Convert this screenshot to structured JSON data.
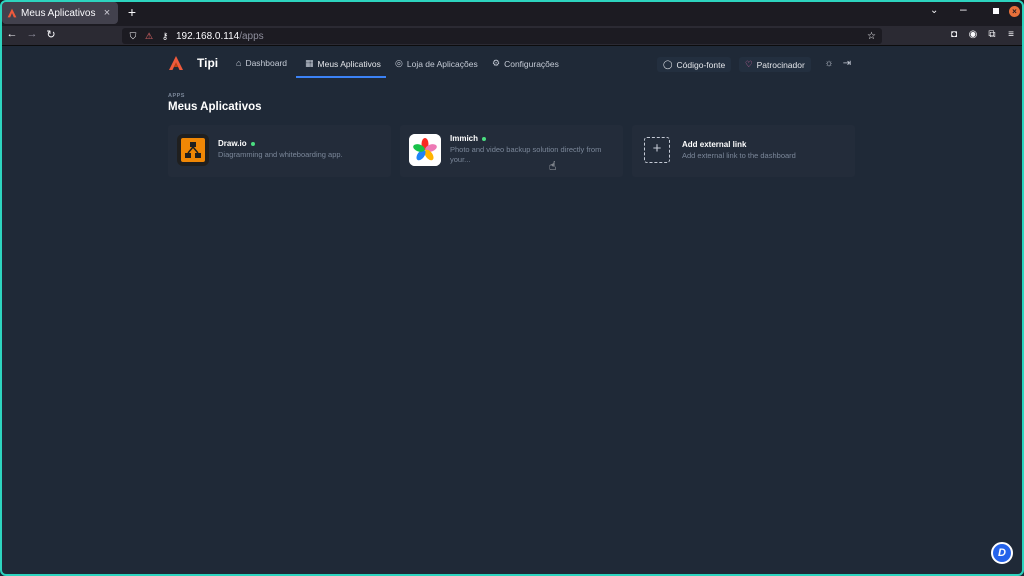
{
  "browser": {
    "tab_title": "Meus Aplicativos - Ti",
    "tab_close": "×",
    "new_tab": "+",
    "url_host": "192.168.0.114",
    "url_path": "/apps"
  },
  "header": {
    "brand": "Tipi",
    "menu": [
      {
        "label": "Dashboard",
        "icon": "home-icon"
      },
      {
        "label": "Meus Aplicativos",
        "icon": "apps-icon",
        "active": true
      },
      {
        "label": "Loja de Aplicações",
        "icon": "store-icon"
      },
      {
        "label": "Configurações",
        "icon": "settings-icon"
      }
    ],
    "source_link": "Código-fonte",
    "sponsor_link": "Patrocinador"
  },
  "page": {
    "pretitle": "APPS",
    "title": "Meus Aplicativos"
  },
  "apps": [
    {
      "name": "Draw.io",
      "description": "Diagramming and whiteboarding app.",
      "status": "running"
    },
    {
      "name": "Immich",
      "description": "Photo and video backup solution directly from your...",
      "status": "running"
    },
    {
      "name": "Add external link",
      "description": "Add external link to the dashboard"
    }
  ],
  "colors": {
    "accent": "#3b82f6",
    "status_running": "#4ade80",
    "frame": "#2dd4bf"
  }
}
